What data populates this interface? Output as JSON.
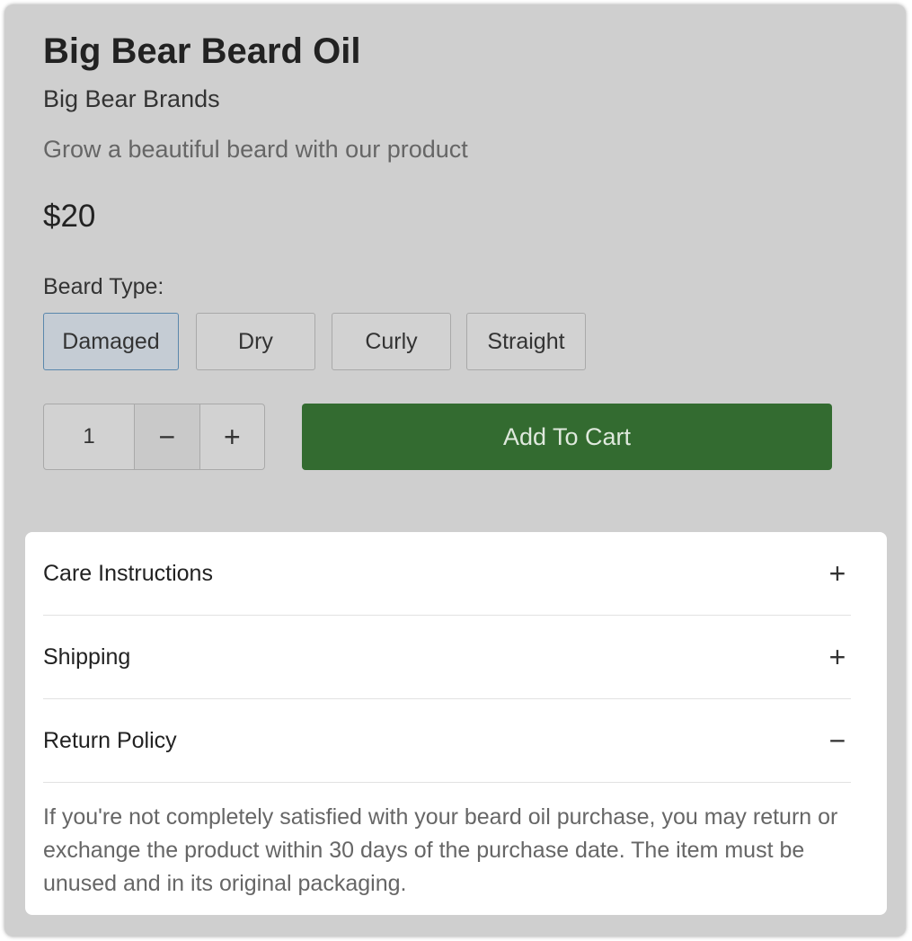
{
  "product": {
    "title": "Big Bear Beard Oil",
    "brand": "Big Bear Brands",
    "tagline": "Grow a beautiful beard with our product",
    "price": "$20"
  },
  "beard_type": {
    "label": "Beard Type:",
    "selected": "Damaged",
    "options": [
      "Damaged",
      "Dry",
      "Curly",
      "Straight"
    ]
  },
  "quantity": {
    "value": "1",
    "minus_symbol": "−",
    "plus_symbol": "+"
  },
  "cart": {
    "label": "Add To Cart",
    "color": "#336b30"
  },
  "accordion": {
    "items": [
      {
        "label": "Care Instructions",
        "icon": "plus-icon",
        "symbol": "+",
        "expanded": false
      },
      {
        "label": "Shipping",
        "icon": "plus-icon",
        "symbol": "+",
        "expanded": false
      },
      {
        "label": "Return Policy",
        "icon": "minus-icon",
        "symbol": "−",
        "expanded": true
      }
    ],
    "return_policy_text": "If you're not completely satisfied with your beard oil purchase, you may return or exchange the product within 30 days of the purchase date. The item must be unused and in its original packaging."
  }
}
